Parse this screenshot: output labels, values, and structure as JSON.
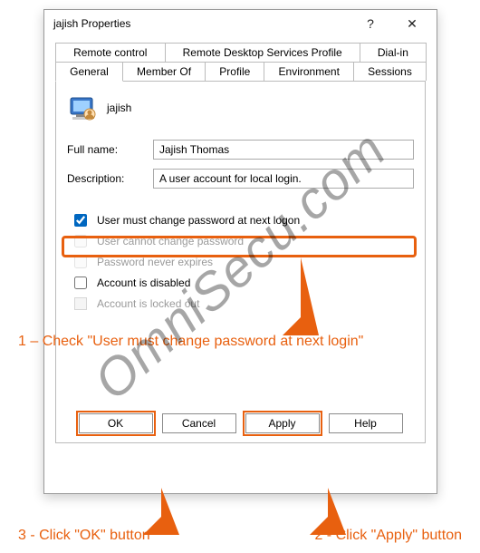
{
  "window": {
    "title": "jajish Properties",
    "help_icon": "?",
    "close_icon": "✕"
  },
  "tabs_row1": [
    "Remote control",
    "Remote Desktop Services Profile",
    "Dial-in"
  ],
  "tabs_row2": [
    "General",
    "Member Of",
    "Profile",
    "Environment",
    "Sessions"
  ],
  "active_tab": "General",
  "user": {
    "name": "jajish"
  },
  "fields": {
    "fullname_label": "Full name:",
    "fullname_value": "Jajish Thomas",
    "description_label": "Description:",
    "description_value": "A user account for local login."
  },
  "checkboxes": {
    "c1": {
      "label": "User must change password at next logon",
      "checked": true,
      "enabled": true
    },
    "c2": {
      "label": "User cannot change password",
      "checked": false,
      "enabled": false
    },
    "c3": {
      "label": "Password never expires",
      "checked": false,
      "enabled": false
    },
    "c4": {
      "label": "Account is disabled",
      "checked": false,
      "enabled": true
    },
    "c5": {
      "label": "Account is locked out",
      "checked": false,
      "enabled": false
    }
  },
  "buttons": {
    "ok": "OK",
    "cancel": "Cancel",
    "apply": "Apply",
    "help": "Help"
  },
  "annotations": {
    "a1": "1 – Check \"User must change password at next login\"",
    "a2": "2 - Click \"Apply\" button",
    "a3": "3 - Click \"OK\" button"
  },
  "watermark": "OmniSecu.com",
  "colors": {
    "accent": "#e8600f"
  }
}
